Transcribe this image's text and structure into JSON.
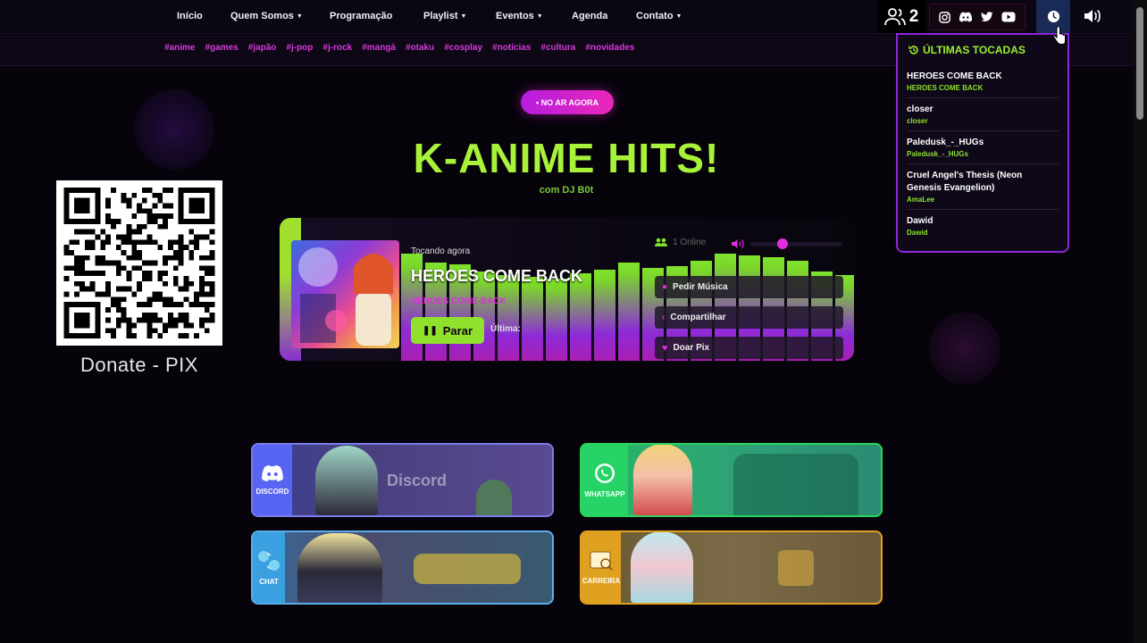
{
  "nav": {
    "items": [
      {
        "label": "Início",
        "caret": false
      },
      {
        "label": "Quem Somos",
        "caret": true
      },
      {
        "label": "Programação",
        "caret": false
      },
      {
        "label": "Playlist",
        "caret": true
      },
      {
        "label": "Eventos",
        "caret": true
      },
      {
        "label": "Agenda",
        "caret": false
      },
      {
        "label": "Contato",
        "caret": true
      }
    ],
    "listeners_count": "2"
  },
  "tags": [
    "#anime",
    "#games",
    "#japão",
    "#j-pop",
    "#j-rock",
    "#mangá",
    "#otaku",
    "#cosplay",
    "#notícias",
    "#cultura",
    "#novidades"
  ],
  "hero": {
    "live_badge": "• NO AR AGORA",
    "show_title": "K-ANIME HITS!",
    "dj": "com DJ B0t"
  },
  "donate": {
    "label": "Donate - PIX"
  },
  "player": {
    "now_playing_label": "Tocando agora",
    "track_title": "HEROES COME BACK",
    "track_artist": "HEROES COME BACK",
    "stop_label": "Parar",
    "last_label": "Última:",
    "online_label": "1 Online",
    "volume": 0.35,
    "buttons": [
      "Pedir Música",
      "Compartilhar",
      "Doar Pix"
    ]
  },
  "history": {
    "title": "ÚLTIMAS TOCADAS",
    "items": [
      {
        "song": "HEROES COME BACK",
        "artist": "HEROES COME BACK"
      },
      {
        "song": "closer",
        "artist": "closer"
      },
      {
        "song": "Paledusk_-_HUGs",
        "artist": "Paledusk_-_HUGs"
      },
      {
        "song": "Cruel Angel's Thesis (Neon Genesis Evangelion)",
        "artist": "AmaLee"
      },
      {
        "song": "Dawid",
        "artist": "Dawid"
      }
    ]
  },
  "cards": {
    "discord": {
      "side_label": "DISCORD",
      "word": "Discord",
      "color": "#5865f2"
    },
    "whatsapp": {
      "side_label": "WHATSAPP",
      "color": "#25d366"
    },
    "chat": {
      "side_label": "CHAT",
      "color": "#3aa0e0"
    },
    "carreira": {
      "side_label": "CARREIRA",
      "color": "#e0a020"
    }
  }
}
